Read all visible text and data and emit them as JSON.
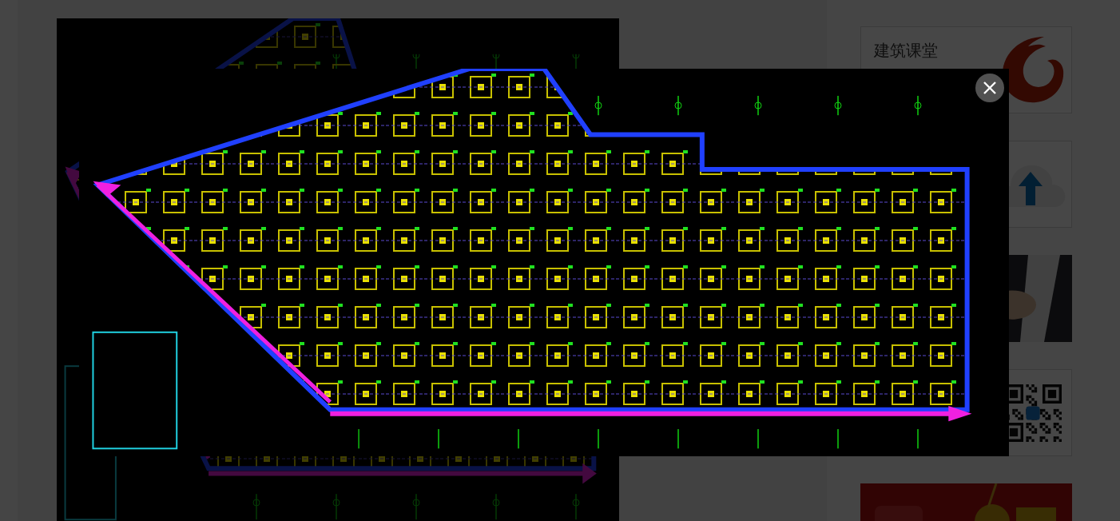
{
  "article": {
    "image": {
      "kind": "picture"
    }
  },
  "sidebar": {
    "cards": [
      {
        "kind": "course",
        "title": "建筑课堂"
      },
      {
        "kind": "upload"
      },
      {
        "kind": "picture"
      },
      {
        "kind": "qr"
      },
      {
        "kind": "banner"
      }
    ]
  },
  "lightbox": {
    "open": true,
    "image": {
      "kind": "picture"
    }
  }
}
